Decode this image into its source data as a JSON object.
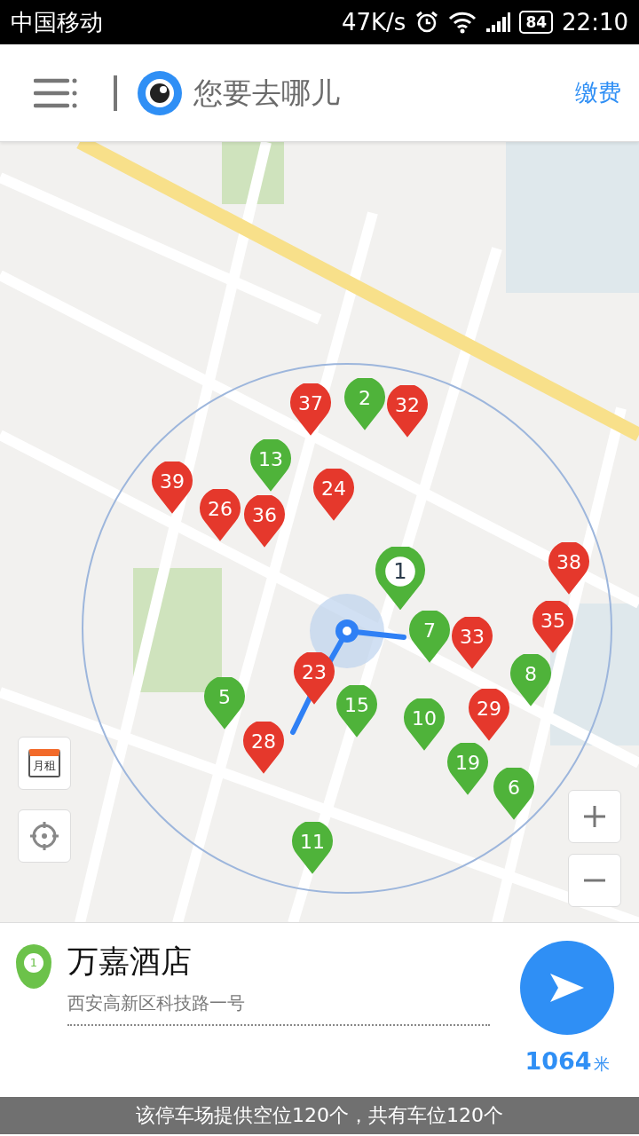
{
  "status_bar": {
    "carrier": "中国移动",
    "speed": "47K/s",
    "battery": "84",
    "time": "22:10"
  },
  "header": {
    "search_placeholder": "您要去哪儿",
    "action": "缴费"
  },
  "map": {
    "monthly_label": "月租",
    "pins": [
      {
        "label": "37",
        "color": "#e5382c",
        "selected": false
      },
      {
        "label": "2",
        "color": "#4fb33a",
        "selected": false
      },
      {
        "label": "32",
        "color": "#e5382c",
        "selected": false
      },
      {
        "label": "13",
        "color": "#4fb33a",
        "selected": false
      },
      {
        "label": "39",
        "color": "#e5382c",
        "selected": false
      },
      {
        "label": "26",
        "color": "#e5382c",
        "selected": false
      },
      {
        "label": "36",
        "color": "#e5382c",
        "selected": false
      },
      {
        "label": "24",
        "color": "#e5382c",
        "selected": false
      },
      {
        "label": "1",
        "color": "#4fb33a",
        "selected": true
      },
      {
        "label": "7",
        "color": "#4fb33a",
        "selected": false
      },
      {
        "label": "33",
        "color": "#e5382c",
        "selected": false
      },
      {
        "label": "38",
        "color": "#e5382c",
        "selected": false
      },
      {
        "label": "35",
        "color": "#e5382c",
        "selected": false
      },
      {
        "label": "8",
        "color": "#4fb33a",
        "selected": false
      },
      {
        "label": "23",
        "color": "#e5382c",
        "selected": false
      },
      {
        "label": "5",
        "color": "#4fb33a",
        "selected": false
      },
      {
        "label": "15",
        "color": "#4fb33a",
        "selected": false
      },
      {
        "label": "28",
        "color": "#e5382c",
        "selected": false
      },
      {
        "label": "10",
        "color": "#4fb33a",
        "selected": false
      },
      {
        "label": "29",
        "color": "#e5382c",
        "selected": false
      },
      {
        "label": "19",
        "color": "#4fb33a",
        "selected": false
      },
      {
        "label": "6",
        "color": "#4fb33a",
        "selected": false
      },
      {
        "label": "11",
        "color": "#4fb33a",
        "selected": false
      }
    ]
  },
  "place": {
    "pin_label": "1",
    "name": "万嘉酒店",
    "address": "西安高新区科技路一号",
    "distance": "1064",
    "distance_unit": "米"
  },
  "notice": "该停车场提供空位120个，共有车位120个"
}
